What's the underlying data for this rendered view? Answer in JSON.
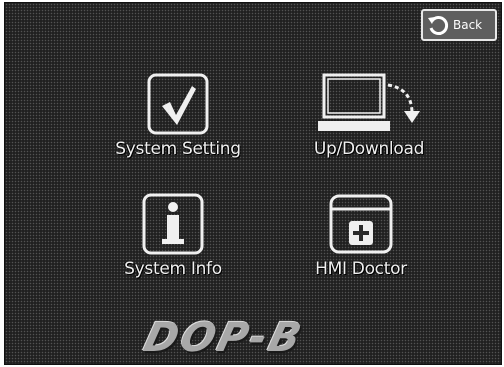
{
  "header": {
    "back_label": "Back",
    "back_icon": "back-arrow-circle-icon"
  },
  "menu": {
    "system_setting": {
      "label": "System Setting",
      "icon": "checkmark-icon"
    },
    "updownload": {
      "label": "Up/Download",
      "icon": "computer-download-icon"
    },
    "system_info": {
      "label": "System Info",
      "icon": "info-icon"
    },
    "hmi_doctor": {
      "label": "HMI Doctor",
      "icon": "medical-kit-icon"
    }
  },
  "brand": {
    "text": "DOP-B"
  },
  "colors": {
    "screen_bg": "#2b2b2b",
    "foreground": "#f0f0f0",
    "back_button_bg": "#5e5e5e"
  }
}
